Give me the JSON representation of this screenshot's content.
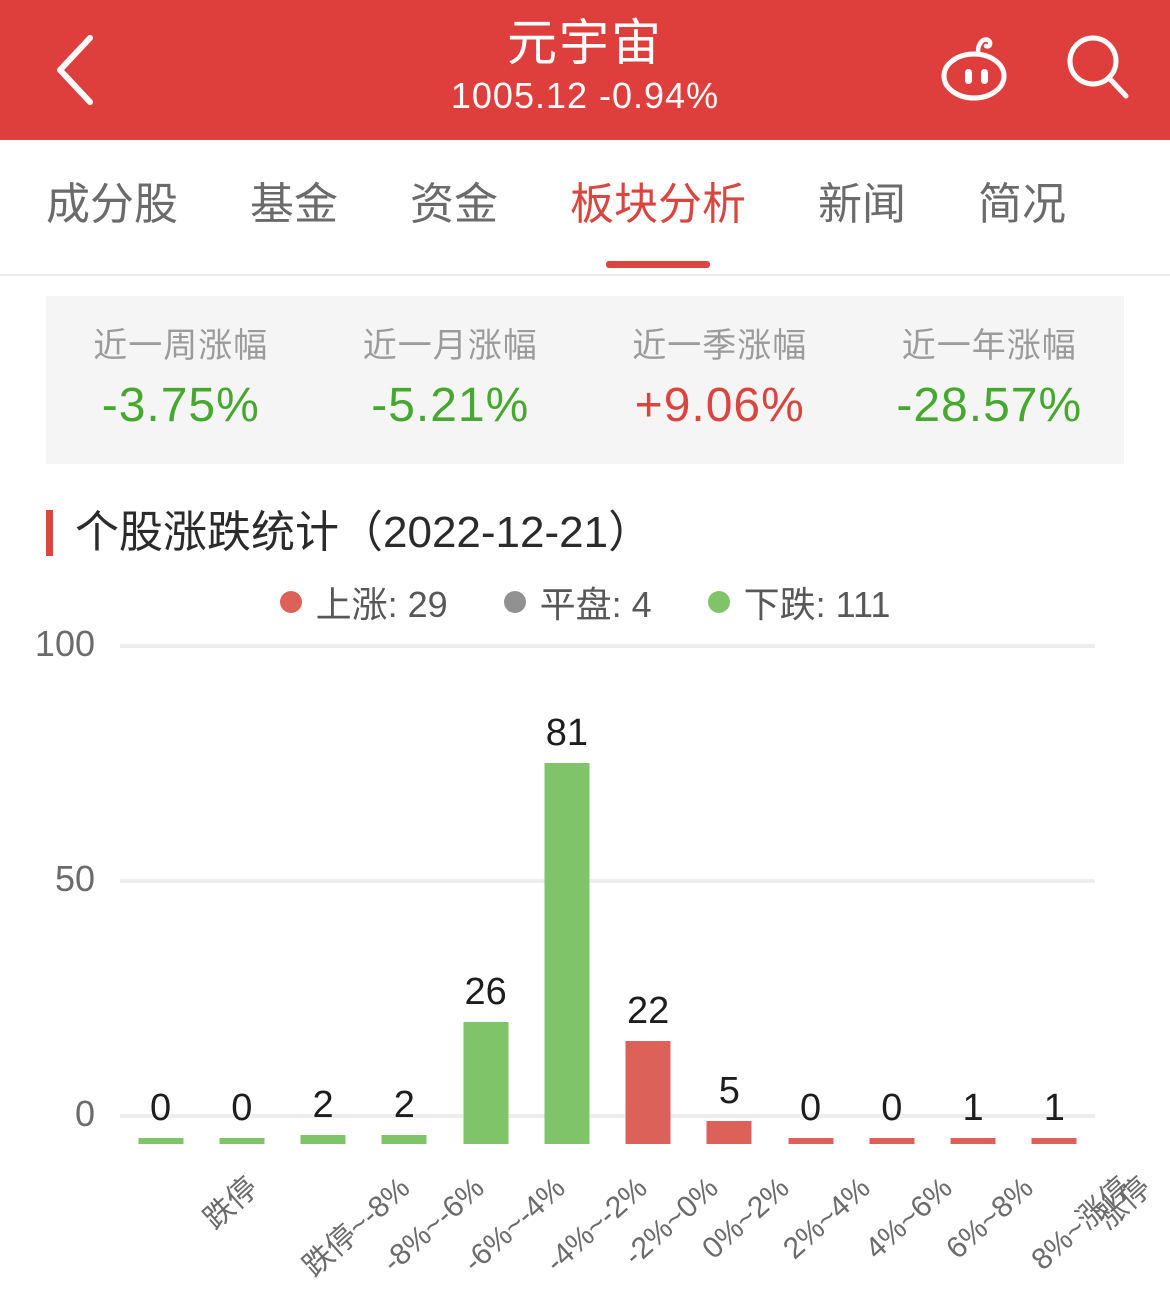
{
  "header": {
    "title": "元宇宙",
    "subtitle": "1005.12 -0.94%",
    "back_icon": "chevron-left-icon",
    "robot_icon": "robot-icon",
    "search_icon": "search-icon",
    "background_color": "#de3f3c"
  },
  "tabs": [
    {
      "label": "成分股",
      "active": false
    },
    {
      "label": "基金",
      "active": false
    },
    {
      "label": "资金",
      "active": false
    },
    {
      "label": "板块分析",
      "active": true
    },
    {
      "label": "新闻",
      "active": false
    },
    {
      "label": "简况",
      "active": false
    }
  ],
  "stats": [
    {
      "label": "近一周涨幅",
      "value": "-3.75%",
      "direction": "down"
    },
    {
      "label": "近一月涨幅",
      "value": "-5.21%",
      "direction": "down"
    },
    {
      "label": "近一季涨幅",
      "value": "+9.06%",
      "direction": "up"
    },
    {
      "label": "近一年涨幅",
      "value": "-28.57%",
      "direction": "down"
    }
  ],
  "section": {
    "title": "个股涨跌统计（2022-12-21）"
  },
  "colors": {
    "up": "#dc6159",
    "flat": "#919191",
    "down": "#7fc468",
    "accent": "#d9453f",
    "grid": "#ededed"
  },
  "chart_data": {
    "type": "bar",
    "title": "个股涨跌统计（2022-12-21）",
    "xlabel": "",
    "ylabel": "",
    "ylim": [
      0,
      100
    ],
    "yticks": [
      0,
      50,
      100
    ],
    "grid": true,
    "legend_position": "top-center",
    "legend": [
      {
        "name": "上涨",
        "value": 29,
        "color": "#dc6159"
      },
      {
        "name": "平盘",
        "value": 4,
        "color": "#919191"
      },
      {
        "name": "下跌",
        "value": 111,
        "color": "#7fc468"
      }
    ],
    "categories": [
      "跌停",
      "跌停~-8%",
      "-8%~-6%",
      "-6%~-4%",
      "-4%~-2%",
      "-2%~0%",
      "0%~2%",
      "2%~4%",
      "4%~6%",
      "6%~8%",
      "8%~涨停",
      "涨停"
    ],
    "values": [
      0,
      0,
      2,
      2,
      26,
      81,
      22,
      5,
      0,
      0,
      1,
      1
    ],
    "bar_colors": [
      "down",
      "down",
      "down",
      "down",
      "down",
      "down",
      "up",
      "up",
      "up",
      "up",
      "up",
      "up"
    ]
  }
}
